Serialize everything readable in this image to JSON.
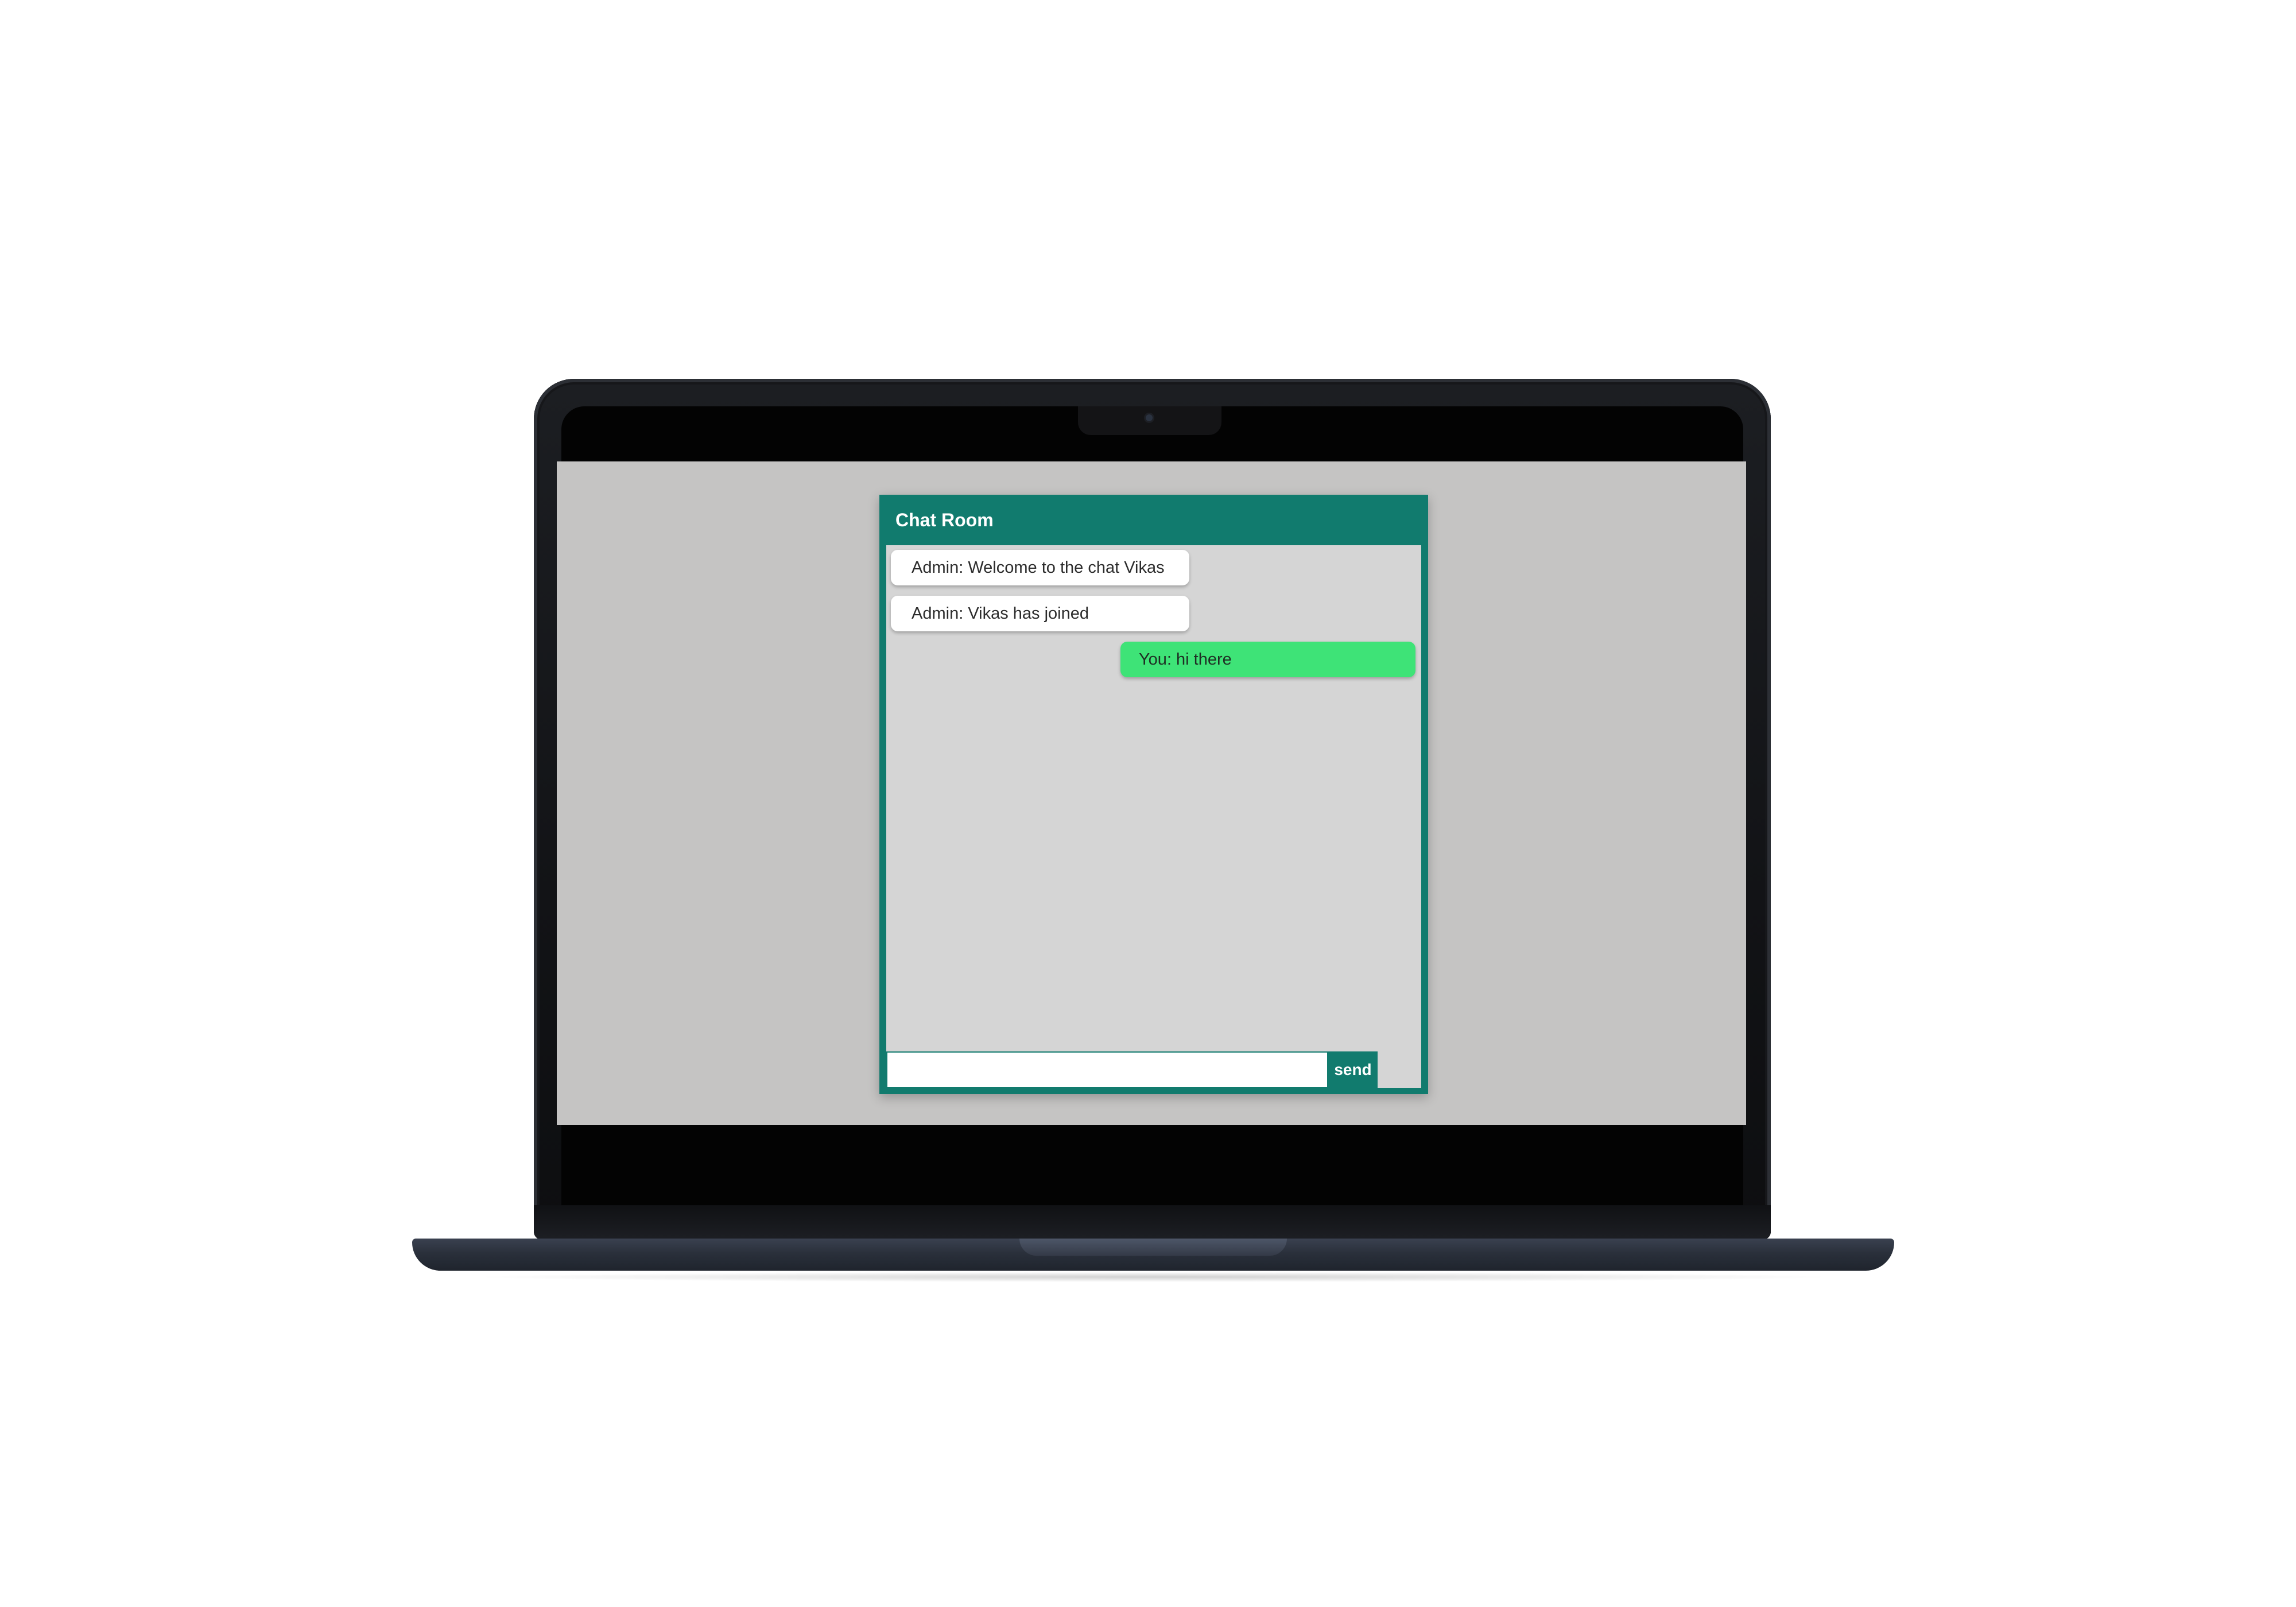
{
  "chat": {
    "title": "Chat Room",
    "messages": [
      {
        "text": "Admin: Welcome to the chat Vikas",
        "direction": "incoming"
      },
      {
        "text": "Admin: Vikas has joined",
        "direction": "incoming"
      },
      {
        "text": "You: hi there",
        "direction": "outgoing"
      }
    ],
    "input_value": "",
    "send_label": "send"
  },
  "colors": {
    "accent": "#117b6e",
    "outgoing_bubble": "#3ee377",
    "incoming_bubble": "#ffffff",
    "chat_background": "#d5d5d5",
    "screen_background": "#c5c4c3"
  }
}
